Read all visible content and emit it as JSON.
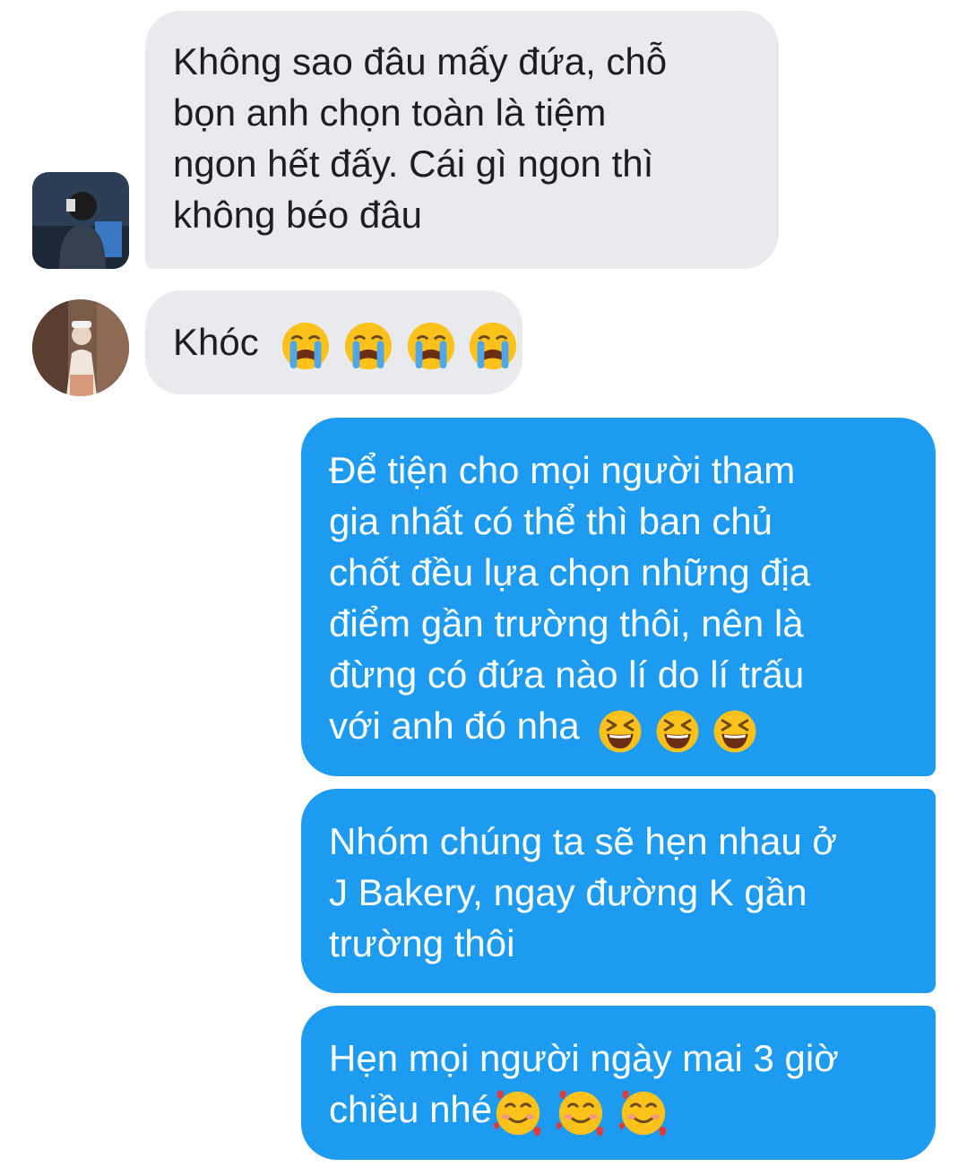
{
  "conversation": {
    "messages": [
      {
        "direction": "incoming",
        "lines": [
          "Không sao đâu mấy đứa, chỗ",
          "bọn anh chọn toàn là tiệm",
          "ngon hết đấy. Cái gì ngon thì",
          "không béo đâu"
        ],
        "emojis": []
      },
      {
        "direction": "incoming",
        "lines": [
          "Khóc"
        ],
        "emojis": [
          "loudly-crying-face-emoji",
          "loudly-crying-face-emoji",
          "loudly-crying-face-emoji",
          "loudly-crying-face-emoji"
        ]
      },
      {
        "direction": "outgoing",
        "lines": [
          "Để tiện cho mọi người tham",
          "gia nhất có thể thì ban chủ",
          "chốt đều lựa chọn những địa",
          "điểm gần trường thôi, nên là",
          "đừng có đứa nào lí do lí trấu",
          "với anh đó nha"
        ],
        "emojis": [
          "grinning-squinting-face-emoji",
          "grinning-squinting-face-emoji",
          "grinning-squinting-face-emoji"
        ]
      },
      {
        "direction": "outgoing",
        "lines": [
          "Nhóm chúng ta sẽ hẹn nhau ở",
          "J Bakery, ngay đường K gần",
          "trường thôi"
        ],
        "emojis": []
      },
      {
        "direction": "outgoing",
        "lines": [
          "Hẹn mọi người ngày mai 3 giờ",
          "chiều nhé"
        ],
        "emojis": [
          "smiling-face-with-hearts-emoji",
          "smiling-face-with-hearts-emoji",
          "smiling-face-with-hearts-emoji"
        ]
      }
    ]
  },
  "colors": {
    "incoming_bubble": "#e9eaee",
    "outgoing_bubble": "#1d9bf0",
    "incoming_text": "#1c1e21",
    "outgoing_text": "#ffffff"
  }
}
